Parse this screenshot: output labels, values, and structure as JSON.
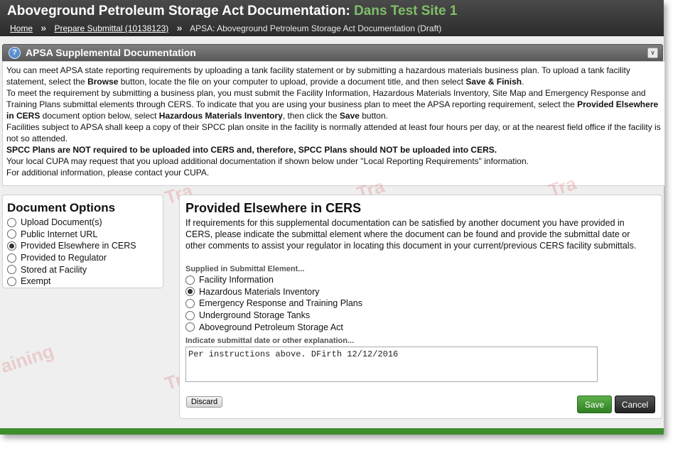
{
  "header": {
    "title_prefix": "Aboveground Petroleum Storage Act Documentation:",
    "site_name": "Dans Test Site 1",
    "breadcrumbs": [
      "Home",
      "Prepare Submittal (10138123)",
      "APSA: Aboveground Petroleum Storage Act Documentation (Draft)"
    ],
    "separator": "»"
  },
  "panel": {
    "title": "APSA Supplemental Documentation",
    "intro": {
      "p1_a": "You can meet APSA state reporting requirements by uploading a tank facility statement or by submitting a hazardous materials business plan. To upload a tank facility statement, select the ",
      "p1_b": "Browse",
      "p1_c": " button, locate the file on your computer to upload, provide a document title, and then select ",
      "p1_d": "Save & Finish",
      "p1_e": ".",
      "p2_a": "To meet the requirement by submitting a business plan, you must submit the Facility Information, Hazardous Materials Inventory, Site Map and Emergency Response and Training Plans submittal elements through CERS. To indicate that you are using your business plan to meet the APSA reporting requirement, select the ",
      "p2_b": "Provided Elsewhere in CERS",
      "p2_c": " document option below, select ",
      "p2_d": "Hazardous Materials Inventory",
      "p2_e": ", then click the ",
      "p2_f": "Save",
      "p2_g": " button.",
      "p3": "Facilities subject to APSA shall keep a copy of their SPCC plan onsite in the facility is normally attended at least four hours per day, or at the nearest field office if the facility is not so attended.",
      "p4": "SPCC Plans are NOT required to be uploaded into CERS and, therefore, SPCC Plans should NOT be uploaded into CERS.",
      "p5": "Your local CUPA may request that you upload additional documentation if shown below under \"Local Reporting Requirements\" information.",
      "p6": "For additional information, please contact your CUPA."
    }
  },
  "document_options": {
    "heading": "Document Options",
    "items": [
      {
        "label": "Upload Document(s)",
        "selected": false
      },
      {
        "label": "Public Internet URL",
        "selected": false
      },
      {
        "label": "Provided Elsewhere in CERS",
        "selected": true
      },
      {
        "label": "Provided to Regulator",
        "selected": false
      },
      {
        "label": "Stored at Facility",
        "selected": false
      },
      {
        "label": "Exempt",
        "selected": false
      }
    ]
  },
  "main": {
    "heading": "Provided Elsewhere in CERS",
    "description": "If requirements for this supplemental documentation can be satisfied by another document you have provided in CERS, please indicate the submittal element where the document can be found and provide the submittal date or other comments to assist your regulator in locating this document in your current/previous CERS facility submittals.",
    "element_label": "Supplied in Submittal Element...",
    "elements": [
      {
        "label": "Facility Information",
        "selected": false
      },
      {
        "label": "Hazardous Materials Inventory",
        "selected": true
      },
      {
        "label": "Emergency Response and Training Plans",
        "selected": false
      },
      {
        "label": "Underground Storage Tanks",
        "selected": false
      },
      {
        "label": "Aboveground Petroleum Storage Act",
        "selected": false
      }
    ],
    "explanation_label": "Indicate submittal date or other explanation...",
    "explanation_value": "Per instructions above. DFirth 12/12/2016",
    "buttons": {
      "discard": "Discard",
      "save": "Save",
      "cancel": "Cancel"
    }
  },
  "watermark": {
    "text_a": "Tra",
    "text_b": "aining",
    "text_c": "Tra"
  },
  "colors": {
    "site_name": "#7fbf6a",
    "save_button": "#3e8e2d",
    "header_bg": "#333333"
  }
}
